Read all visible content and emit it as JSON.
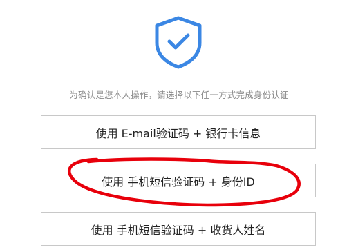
{
  "header": {
    "icon": "shield-check-icon",
    "icon_color": "#3b87e4"
  },
  "instruction": "为确认是您本人操作，请选择以下任一方式完成身份认证",
  "options": [
    {
      "label": "使用 E-mail验证码 + 银行卡信息"
    },
    {
      "label": "使用 手机短信验证码 + 身份ID"
    },
    {
      "label": "使用 手机短信验证码 + 收货人姓名"
    }
  ],
  "annotation": {
    "type": "hand-drawn-circle",
    "color": "#e8000b",
    "target": "options.1"
  }
}
